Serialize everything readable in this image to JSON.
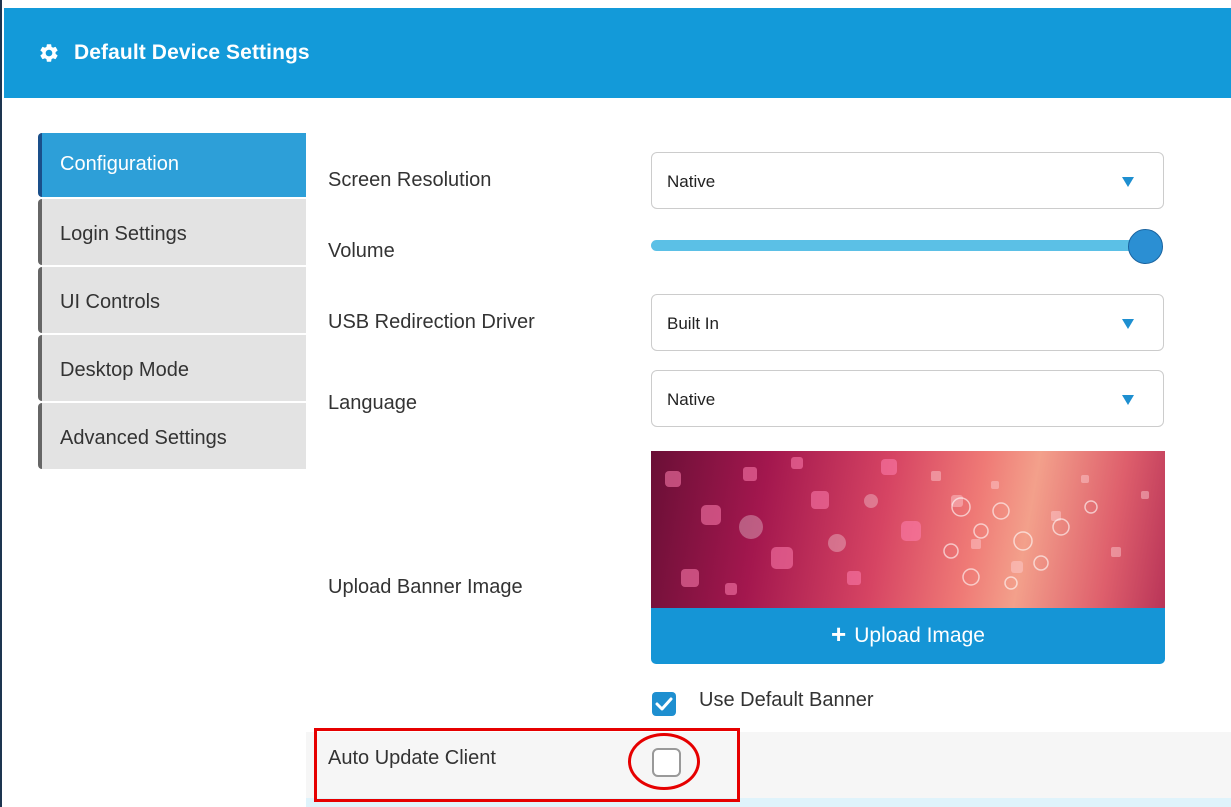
{
  "header": {
    "title": "Default Device Settings",
    "icon": "gear-icon",
    "color": "#139ad9"
  },
  "sidebar": {
    "tabs": [
      {
        "label": "Configuration",
        "active": true
      },
      {
        "label": "Login Settings",
        "active": false
      },
      {
        "label": "UI Controls",
        "active": false
      },
      {
        "label": "Desktop Mode",
        "active": false
      },
      {
        "label": "Advanced Settings",
        "active": false
      }
    ]
  },
  "form": {
    "screen_resolution": {
      "label": "Screen Resolution",
      "value": "Native"
    },
    "volume": {
      "label": "Volume",
      "level_percent": 100
    },
    "usb_driver": {
      "label": "USB Redirection Driver",
      "value": "Built In"
    },
    "language": {
      "label": "Language",
      "value": "Native"
    },
    "banner": {
      "label": "Upload Banner Image",
      "button_label": "Upload Image"
    },
    "use_default_banner": {
      "label": "Use Default Banner",
      "checked": true
    },
    "auto_update": {
      "label": "Auto Update Client",
      "checked": false
    }
  },
  "colors": {
    "accent": "#1e8fd0",
    "highlight": "#e60000"
  }
}
